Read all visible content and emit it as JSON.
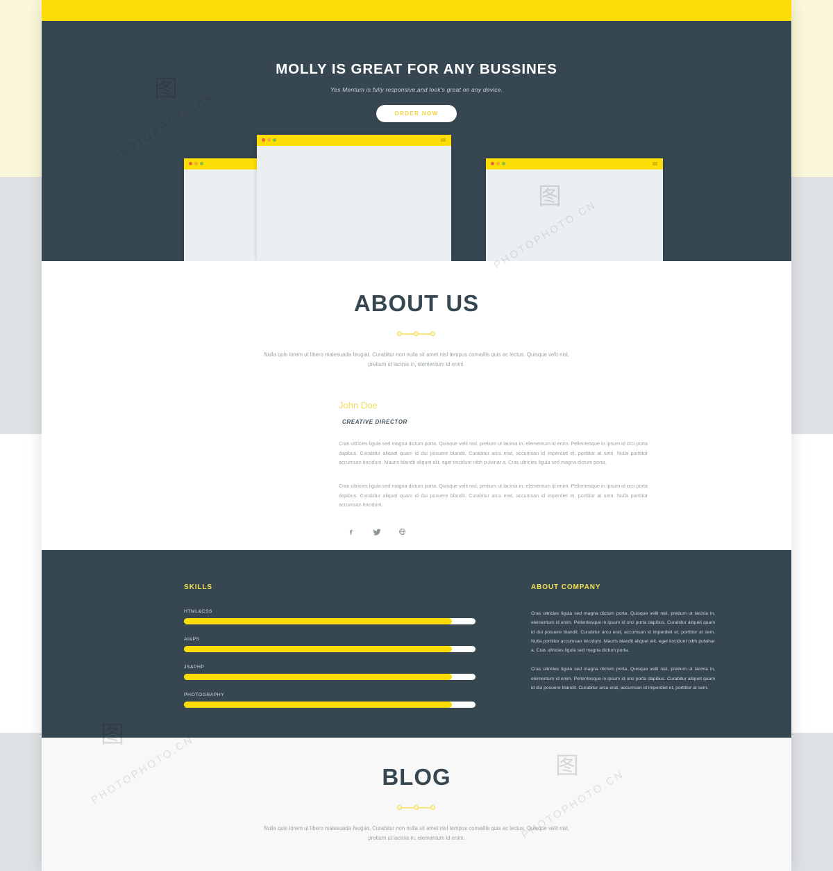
{
  "hero": {
    "title": "MOLLY IS GREAT FOR ANY BUSSINES",
    "subtitle": "Yes Mentum is fully responsive,and look's great on any device.",
    "cta_label": "ORDER NOW"
  },
  "colors": {
    "accent_yellow": "#fcdd05",
    "dark_slate": "#374752",
    "muted_text": "#9aa4ab",
    "page_bg": "#ffffff",
    "band_cream": "#fbf7da",
    "band_gray": "#dfe2e4",
    "blog_bg": "#f8f8f8"
  },
  "about": {
    "title": "ABOUT US",
    "lead": "Nulla quis lorem ut libero malesuada feugiat. Curabitur non nulla sit amet nisl tempus convallis quis ac lectus. Quisque velit nisl, pretium ut lacinia in, elementum id enim.",
    "placeholder_left": "370x440",
    "placeholder_right": "370x440",
    "profile": {
      "name": "John Doe",
      "role": "CREATIVE DIRECTOR",
      "paragraph_1": "Cras ultricies ligula sed magna dictum porta. Quisque velit nisl, pretium ut lacinia in, elementum id enim. Pellentesque in ipsum id orci porta dapibus. Curabitur aliquet quam id dui posuere blandit. Curabitur arcu erat, accumsan id imperdiet et, porttitor at sem. Nulla porttitor accumsan tincidunt. Mauris blandit aliquet elit, eget tincidunt nibh pulvinar a. Cras ultricies ligula sed magna dictum porta.",
      "paragraph_2": "Cras ultricies ligula sed magna dictum porta. Quisque velit nisl, pretium ut lacinia in, elementum id enim. Pellentesque in ipsum id orci porta dapibus. Curabitur aliquet quam id dui posuere blandit. Curabitur arcu erat, accumsan id imperdiet et, porttitor at sem. Nulla porttitor accumsan tincidunt.",
      "socials": [
        {
          "name": "facebook-icon",
          "glyph": "f"
        },
        {
          "name": "twitter-icon",
          "glyph": "t"
        },
        {
          "name": "dribbble-icon",
          "glyph": "d"
        }
      ]
    }
  },
  "skills": {
    "heading": "SKILLS",
    "items": [
      {
        "label": "HTML&CSS",
        "value": 92
      },
      {
        "label": "AI&PS",
        "value": 92
      },
      {
        "label": "JS&PHP",
        "value": 92
      },
      {
        "label": "PHOTOGRAPHY",
        "value": 92
      }
    ]
  },
  "company": {
    "heading": "ABOUT COMPANY",
    "paragraph_1": "Cras ultricies ligula sed magna dictum porta. Quisque velit nisl, pretium ut lacinia in, elementum id enim. Pellentesque in ipsum id orci porta dapibus. Curabitur aliquet quam id dui posuere blandit. Curabitur arcu erat, accumsan id imperdiet et, porttitor at sem. Nulla porttitor accumsan tincidunt. Mauris blandit aliquet elit, eget tincidunt nibh pulvinar a. Cras ultricies ligula sed magna dictum porta.",
    "paragraph_2": "Cras ultricies ligula sed magna dictum porta. Quisque velit nisl, pretium ut lacinia in, elementum id enim. Pellentesque in ipsum id orci porta dapibus. Curabitur aliquet quam id dui posuere blandit. Curabitur arcu erat, accumsan id imperdiet et, porttitor at sem."
  },
  "blog": {
    "title": "BLOG",
    "lead": "Nulla quis lorem ut libero malesuada feugiat. Curabitur non nulla sit amet nisl tempus convallis quis ac lectus. Quisque velit nisl, pretium ut lacinia in, elementum id enim."
  },
  "watermarks": {
    "text": "PHOTOPHOTO.CN"
  }
}
